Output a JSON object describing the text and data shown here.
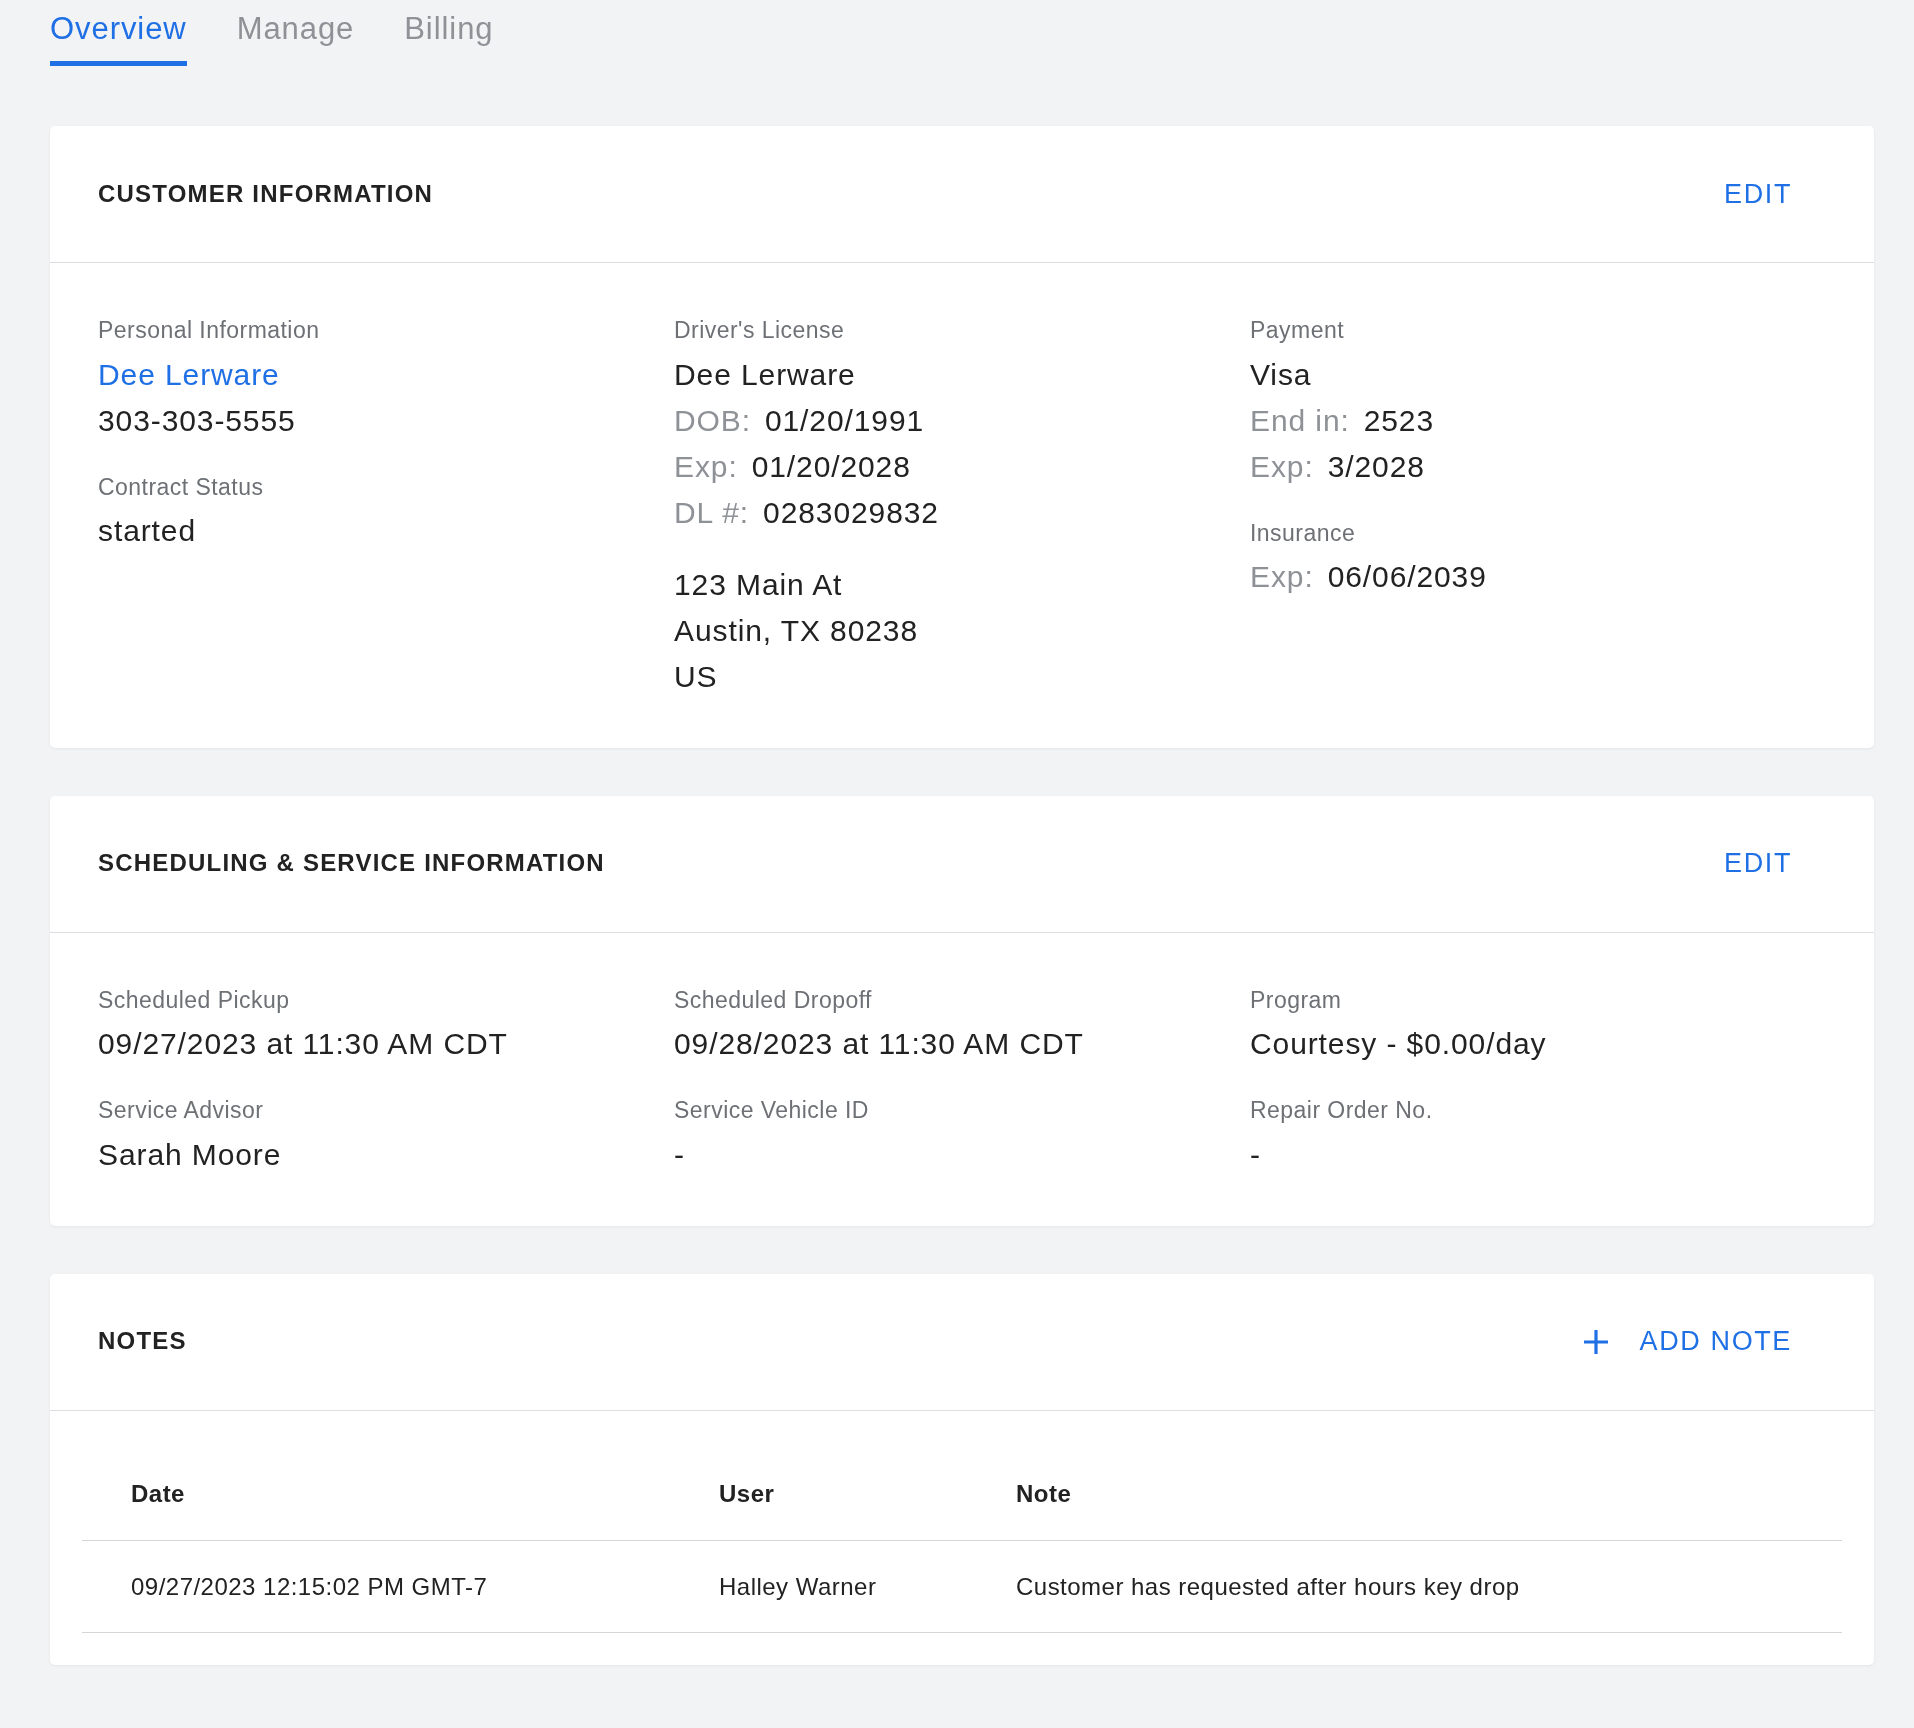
{
  "tabs": [
    {
      "label": "Overview",
      "selected": true
    },
    {
      "label": "Manage",
      "selected": false
    },
    {
      "label": "Billing",
      "selected": false
    }
  ],
  "sections": [
    {
      "kind": "fields",
      "title": "CUSTOMER INFORMATION",
      "action": {
        "label": "EDIT"
      },
      "columns": [
        [
          {
            "label": "Personal Information",
            "lines": [
              {
                "value": "Dee Lerware",
                "link": true
              },
              {
                "value": "303-303-5555"
              }
            ]
          },
          {
            "label": "Contract Status",
            "lines": [
              {
                "value": "started"
              }
            ]
          }
        ],
        [
          {
            "label": "Driver's License",
            "lines": [
              {
                "value": "Dee Lerware"
              },
              {
                "prefix": "DOB:",
                "value": "01/20/1991"
              },
              {
                "prefix": "Exp:",
                "value": "01/20/2028"
              },
              {
                "prefix": "DL #:",
                "value": "0283029832"
              }
            ]
          },
          {
            "lines": [
              {
                "value": "123 Main At"
              },
              {
                "value": "Austin, TX 80238"
              },
              {
                "value": "US"
              }
            ]
          }
        ],
        [
          {
            "label": "Payment",
            "lines": [
              {
                "value": "Visa"
              },
              {
                "prefix": "End in:",
                "value": "2523"
              },
              {
                "prefix": "Exp:",
                "value": "3/2028"
              }
            ]
          },
          {
            "label": "Insurance",
            "lines": [
              {
                "prefix": "Exp:",
                "value": "06/06/2039"
              }
            ]
          }
        ]
      ]
    },
    {
      "kind": "fields",
      "title": "SCHEDULING & SERVICE INFORMATION",
      "action": {
        "label": "EDIT"
      },
      "columns": [
        [
          {
            "label": "Scheduled Pickup",
            "lines": [
              {
                "value": "09/27/2023 at 11:30 AM CDT"
              }
            ]
          },
          {
            "label": "Service Advisor",
            "lines": [
              {
                "value": "Sarah Moore"
              }
            ]
          }
        ],
        [
          {
            "label": "Scheduled Dropoff",
            "lines": [
              {
                "value": "09/28/2023 at 11:30 AM CDT"
              }
            ]
          },
          {
            "label": "Service Vehicle ID",
            "lines": [
              {
                "value": "-"
              }
            ]
          }
        ],
        [
          {
            "label": "Program",
            "lines": [
              {
                "value": "Courtesy - $0.00/day"
              }
            ]
          },
          {
            "label": "Repair Order No.",
            "lines": [
              {
                "value": "-"
              }
            ]
          }
        ]
      ]
    },
    {
      "kind": "table",
      "title": "NOTES",
      "action": {
        "label": "ADD NOTE"
      },
      "table": {
        "columns": [
          "Date",
          "User",
          "Note"
        ],
        "rows": [
          [
            "09/27/2023 12:15:02 PM GMT-7",
            "Halley Warner",
            "Customer has requested after hours key drop"
          ]
        ]
      }
    }
  ]
}
